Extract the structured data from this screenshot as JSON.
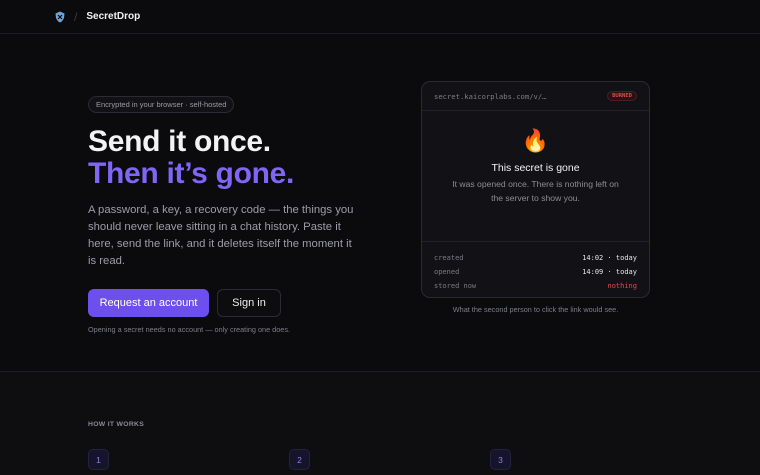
{
  "header": {
    "brand": "SecretDrop",
    "logo_icon": "shield-logo-icon"
  },
  "hero": {
    "badge": "Encrypted in your browser · self-hosted",
    "headline_line1": "Send it once.",
    "headline_line2": "Then it’s gone.",
    "description": "A password, a key, a recovery code — the things you should never leave sitting in a chat history. Paste it here, send the link, and it deletes itself the moment it is read.",
    "primary_button": "Request an account",
    "secondary_button": "Sign in",
    "note": "Opening a secret needs no account — only creating one does."
  },
  "card": {
    "url": "secret.kaicorplabs.com/v/…",
    "status": "BURNED",
    "icon": "fire-icon",
    "title": "This secret is gone",
    "text": "It was opened once. There is nothing left on the server to show you.",
    "rows": [
      {
        "key": "created",
        "value": "14:02 · today"
      },
      {
        "key": "opened",
        "value": "14:09 · today"
      },
      {
        "key": "stored now",
        "value": "nothing"
      }
    ],
    "caption": "What the second person to click the link would see."
  },
  "how": {
    "heading": "HOW IT WORKS",
    "steps": [
      "1",
      "2",
      "3"
    ]
  },
  "colors": {
    "accent": "#7f66f5",
    "button": "#6d4ff0",
    "danger": "#e14a4a",
    "background": "#0b0b0d"
  }
}
